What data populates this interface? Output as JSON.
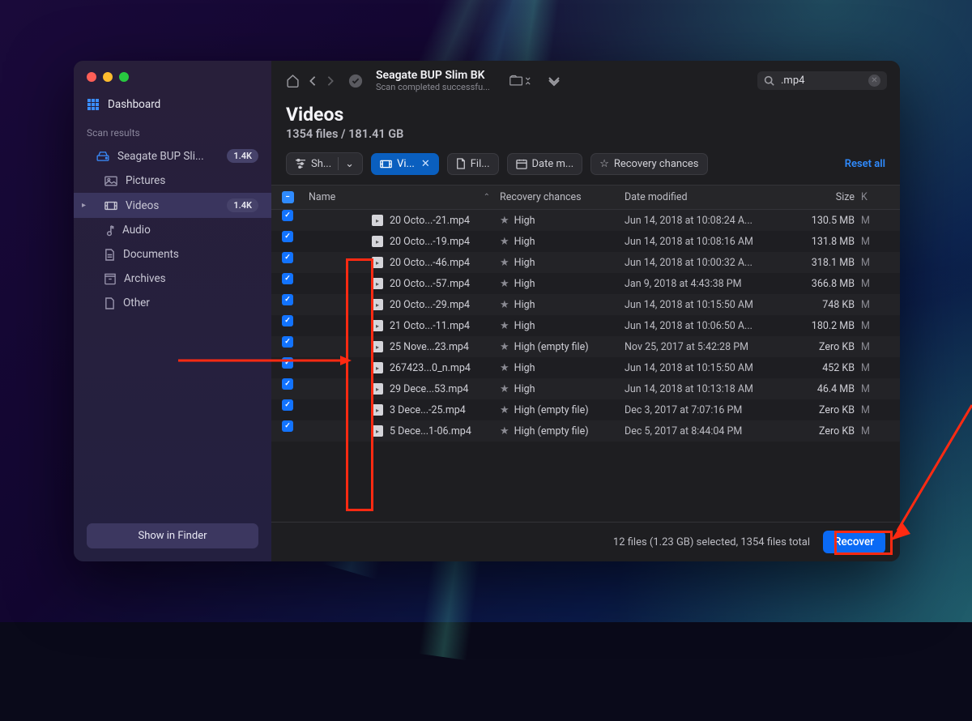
{
  "sidebar": {
    "dashboard": "Dashboard",
    "section_label": "Scan results",
    "items": [
      {
        "icon": "drive",
        "label": "Seagate BUP Sli...",
        "badge": "1.4K"
      },
      {
        "icon": "picture",
        "label": "Pictures"
      },
      {
        "icon": "video",
        "label": "Videos",
        "badge": "1.4K",
        "active": true,
        "chevron": true
      },
      {
        "icon": "audio",
        "label": "Audio"
      },
      {
        "icon": "doc",
        "label": "Documents"
      },
      {
        "icon": "archive",
        "label": "Archives"
      },
      {
        "icon": "other",
        "label": "Other"
      }
    ],
    "finder_btn": "Show in Finder"
  },
  "toolbar": {
    "title": "Seagate BUP Slim BK",
    "subtitle": "Scan completed successfu...",
    "search_value": ".mp4"
  },
  "heading": {
    "title": "Videos",
    "subtitle": "1354 files / 181.41 GB"
  },
  "filters": {
    "show": "Sh...",
    "video": "Vi...",
    "file": "Fil...",
    "date": "Date m...",
    "recovery": "Recovery chances",
    "reset": "Reset all"
  },
  "columns": {
    "name": "Name",
    "recovery": "Recovery chances",
    "date": "Date modified",
    "size": "Size",
    "kind": "K"
  },
  "rows": [
    {
      "name": "20 Octo...-21.mp4",
      "rec": "High",
      "date": "Jun 14, 2018 at 10:08:24 A...",
      "size": "130.5 MB",
      "k": "M"
    },
    {
      "name": "20 Octo...-19.mp4",
      "rec": "High",
      "date": "Jun 14, 2018 at 10:08:16 AM",
      "size": "131.8 MB",
      "k": "M"
    },
    {
      "name": "20 Octo...-46.mp4",
      "rec": "High",
      "date": "Jun 14, 2018 at 10:00:32 A...",
      "size": "318.1 MB",
      "k": "M"
    },
    {
      "name": "20 Octo...-57.mp4",
      "rec": "High",
      "date": "Jan 9, 2018 at 4:43:38 PM",
      "size": "366.8 MB",
      "k": "M"
    },
    {
      "name": "20 Octo...-29.mp4",
      "rec": "High",
      "date": "Jun 14, 2018 at 10:15:50 AM",
      "size": "748 KB",
      "k": "M"
    },
    {
      "name": "21 Octo...-11.mp4",
      "rec": "High",
      "date": "Jun 14, 2018 at 10:06:50 A...",
      "size": "180.2 MB",
      "k": "M"
    },
    {
      "name": "25 Nove...23.mp4",
      "rec": "High (empty file)",
      "date": "Nov 25, 2017 at 5:42:28 PM",
      "size": "Zero KB",
      "k": "M"
    },
    {
      "name": "267423...0_n.mp4",
      "rec": "High",
      "date": "Jun 14, 2018 at 10:15:50 AM",
      "size": "452 KB",
      "k": "M"
    },
    {
      "name": "29 Dece...53.mp4",
      "rec": "High",
      "date": "Jun 14, 2018 at 10:13:18 AM",
      "size": "46.4 MB",
      "k": "M"
    },
    {
      "name": "3 Dece...-25.mp4",
      "rec": "High (empty file)",
      "date": "Dec 3, 2017 at 7:07:16 PM",
      "size": "Zero KB",
      "k": "M"
    },
    {
      "name": "5 Dece...1-06.mp4",
      "rec": "High (empty file)",
      "date": "Dec 5, 2017 at 8:44:04 PM",
      "size": "Zero KB",
      "k": "M"
    }
  ],
  "footer": {
    "status": "12 files (1.23 GB) selected, 1354 files total",
    "recover": "Recover"
  }
}
